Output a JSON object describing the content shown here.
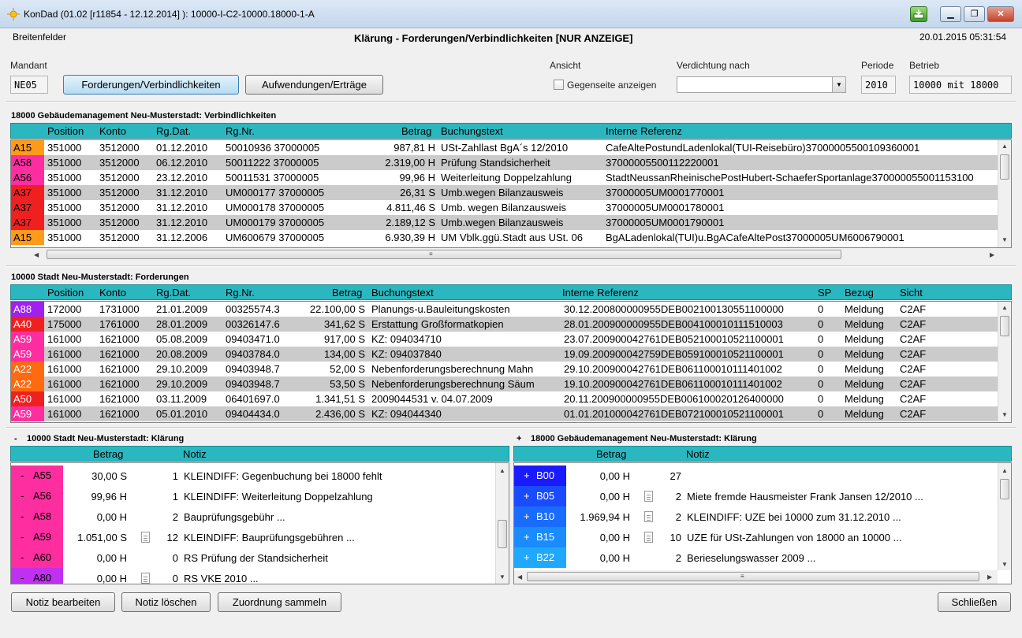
{
  "window": {
    "title": "KonDad (01.02 [r11854 - 12.12.2014] ): 10000-I-C2-10000.18000-1-A",
    "btn_min": "▁",
    "btn_max": "❐",
    "btn_close": "✕"
  },
  "header": {
    "user": "Breitenfelder",
    "title": "Klärung - Forderungen/Verbindlichkeiten [NUR ANZEIGE]",
    "timestamp": "20.01.2015 05:31:54"
  },
  "toolbar": {
    "mandant_label": "Mandant",
    "mandant_value": "NE05",
    "tab_forderungen": "Forderungen/Verbindlichkeiten",
    "tab_aufwendungen": "Aufwendungen/Erträge",
    "ansicht_label": "Ansicht",
    "gegenseite_label": "Gegenseite anzeigen",
    "verdichtung_label": "Verdichtung nach",
    "verdichtung_value": "",
    "periode_label": "Periode",
    "periode_value": "2010",
    "betrieb_label": "Betrieb",
    "betrieb_value": "10000 mit 18000"
  },
  "verbindlichkeiten": {
    "title": "18000 Gebäudemanagement Neu-Musterstadt: Verbindlichkeiten",
    "columns": [
      "Position",
      "Konto",
      "Rg.Dat.",
      "Rg.Nr.",
      "Betrag",
      "Buchungstext",
      "Interne Referenz"
    ],
    "rows": [
      {
        "code": "A15",
        "color": "#ff9a1a",
        "pos": "351000",
        "konto": "3512000",
        "dat": "01.12.2010",
        "nr": "50010936 37000005",
        "betrag": "987,81 H",
        "text": "USt-Zahllast BgA´s 12/2010",
        "ref": "CafeAltePostundLadenlokal(TUI-Reisebüro)37000005500109360001"
      },
      {
        "code": "A58",
        "color": "#ff2ea0",
        "pos": "351000",
        "konto": "3512000",
        "dat": "06.12.2010",
        "nr": "50011222 37000005",
        "betrag": "2.319,00 H",
        "text": "Prüfung Standsicherheit",
        "ref": "37000005500112220001"
      },
      {
        "code": "A56",
        "color": "#ff2ea0",
        "pos": "351000",
        "konto": "3512000",
        "dat": "23.12.2010",
        "nr": "50011531 37000005",
        "betrag": "99,96 H",
        "text": "Weiterleitung Doppelzahlung",
        "ref": "StadtNeussanRheinischePostHubert-SchaeferSportanlage370000055001153100"
      },
      {
        "code": "A37",
        "color": "#f02020",
        "pos": "351000",
        "konto": "3512000",
        "dat": "31.12.2010",
        "nr": "UM000177 37000005",
        "betrag": "26,31 S",
        "text": "Umb.wegen Bilanzausweis",
        "ref": "37000005UM0001770001"
      },
      {
        "code": "A37",
        "color": "#f02020",
        "pos": "351000",
        "konto": "3512000",
        "dat": "31.12.2010",
        "nr": "UM000178 37000005",
        "betrag": "4.811,46 S",
        "text": "Umb. wegen Bilanzausweis",
        "ref": "37000005UM0001780001"
      },
      {
        "code": "A37",
        "color": "#f02020",
        "pos": "351000",
        "konto": "3512000",
        "dat": "31.12.2010",
        "nr": "UM000179 37000005",
        "betrag": "2.189,12 S",
        "text": "Umb.wegen Bilanzausweis",
        "ref": "37000005UM0001790001"
      },
      {
        "code": "A15",
        "color": "#ff9a1a",
        "pos": "351000",
        "konto": "3512000",
        "dat": "31.12.2006",
        "nr": "UM600679 37000005",
        "betrag": "6.930,39 H",
        "text": "UM Vblk.ggü.Stadt aus USt. 06",
        "ref": "BgALadenlokal(TUI)u.BgACafeAltePost37000005UM6006790001"
      }
    ]
  },
  "forderungen": {
    "title": "10000 Stadt Neu-Musterstadt: Forderungen",
    "columns": [
      "Position",
      "Konto",
      "Rg.Dat.",
      "Rg.Nr.",
      "Betrag",
      "Buchungstext",
      "Interne Referenz",
      "SP",
      "Bezug",
      "Sicht"
    ],
    "rows": [
      {
        "code": "A88",
        "color": "#a020f0",
        "pos": "172000",
        "konto": "1731000",
        "dat": "21.01.2009",
        "nr": "00325574.3",
        "betrag": "22.100,00 S",
        "text": "Planungs-u.Bauleitungskosten",
        "ref": "30.12.200800000955DEB002100130551100000",
        "sp": "0",
        "bezug": "Meldung",
        "sicht": "C2AF"
      },
      {
        "code": "A40",
        "color": "#f02020",
        "pos": "175000",
        "konto": "1761000",
        "dat": "28.01.2009",
        "nr": "00326147.6",
        "betrag": "341,62 S",
        "text": "Erstattung Großformatkopien",
        "ref": "28.01.200900000955DEB004100010111510003",
        "sp": "0",
        "bezug": "Meldung",
        "sicht": "C2AF"
      },
      {
        "code": "A59",
        "color": "#ff2ea0",
        "pos": "161000",
        "konto": "1621000",
        "dat": "05.08.2009",
        "nr": "09403471.0",
        "betrag": "917,00 S",
        "text": "KZ: 094034710",
        "ref": "23.07.200900042761DEB052100010521100001",
        "sp": "0",
        "bezug": "Meldung",
        "sicht": "C2AF"
      },
      {
        "code": "A59",
        "color": "#ff2ea0",
        "pos": "161000",
        "konto": "1621000",
        "dat": "20.08.2009",
        "nr": "09403784.0",
        "betrag": "134,00 S",
        "text": "KZ: 094037840",
        "ref": "19.09.200900042759DEB059100010521100001",
        "sp": "0",
        "bezug": "Meldung",
        "sicht": "C2AF"
      },
      {
        "code": "A22",
        "color": "#ff6a10",
        "pos": "161000",
        "konto": "1621000",
        "dat": "29.10.2009",
        "nr": "09403948.7",
        "betrag": "52,00 S",
        "text": "Nebenforderungsberechnung Mahn",
        "ref": "29.10.200900042761DEB061100010111401002",
        "sp": "0",
        "bezug": "Meldung",
        "sicht": "C2AF"
      },
      {
        "code": "A22",
        "color": "#ff6a10",
        "pos": "161000",
        "konto": "1621000",
        "dat": "29.10.2009",
        "nr": "09403948.7",
        "betrag": "53,50 S",
        "text": "Nebenforderungsberechnung Säum",
        "ref": "19.10.200900042761DEB061100010111401002",
        "sp": "0",
        "bezug": "Meldung",
        "sicht": "C2AF"
      },
      {
        "code": "A50",
        "color": "#f02020",
        "pos": "161000",
        "konto": "1621000",
        "dat": "03.11.2009",
        "nr": "06401697.0",
        "betrag": "1.341,51 S",
        "text": "2009044531 v. 04.07.2009",
        "ref": "20.11.200900000955DEB006100020126400000",
        "sp": "0",
        "bezug": "Meldung",
        "sicht": "C2AF"
      },
      {
        "code": "A59",
        "color": "#ff2ea0",
        "pos": "161000",
        "konto": "1621000",
        "dat": "05.01.2010",
        "nr": "09404434.0",
        "betrag": "2.436,00 S",
        "text": "KZ: 094044340",
        "ref": "01.01.201000042761DEB072100010521100001",
        "sp": "0",
        "bezug": "Meldung",
        "sicht": "C2AF"
      }
    ]
  },
  "klaerung_left": {
    "toggle": "-",
    "title": "10000 Stadt Neu-Musterstadt: Klärung",
    "columns": [
      "Betrag",
      "Notiz"
    ],
    "rows": [
      {
        "sign": "-",
        "code": "A55",
        "color": "#ff2ea0",
        "betrag": "30,00 S",
        "doc": false,
        "count": "1",
        "notiz": "KLEINDIFF: Gegenbuchung bei 18000 fehlt"
      },
      {
        "sign": "-",
        "code": "A56",
        "color": "#ff2ea0",
        "betrag": "99,96 H",
        "doc": false,
        "count": "1",
        "notiz": "KLEINDIFF: Weiterleitung Doppelzahlung"
      },
      {
        "sign": "-",
        "code": "A58",
        "color": "#ff2ea0",
        "betrag": "0,00 H",
        "doc": false,
        "count": "2",
        "notiz": "Bauprüfungsgebühr ..."
      },
      {
        "sign": "-",
        "code": "A59",
        "color": "#ff2ea0",
        "betrag": "1.051,00 S",
        "doc": true,
        "count": "12",
        "notiz": "KLEINDIFF: Bauprüfungsgebühren ..."
      },
      {
        "sign": "-",
        "code": "A60",
        "color": "#ff2ea0",
        "betrag": "0,00 H",
        "doc": false,
        "count": "0",
        "notiz": "RS Prüfung der Standsicherheit"
      },
      {
        "sign": "-",
        "code": "A80",
        "color": "#c030f0",
        "betrag": "0,00 H",
        "doc": true,
        "count": "0",
        "notiz": "RS VKE 2010 ..."
      }
    ]
  },
  "klaerung_right": {
    "toggle": "+",
    "title": "18000 Gebäudemanagement Neu-Musterstadt: Klärung",
    "columns": [
      "Betrag",
      "Notiz"
    ],
    "rows": [
      {
        "sign": "+",
        "code": "B00",
        "color": "#1a1aff",
        "betrag": "0,00 H",
        "doc": false,
        "count": "27",
        "notiz": ""
      },
      {
        "sign": "+",
        "code": "B05",
        "color": "#1a4cff",
        "betrag": "0,00 H",
        "doc": true,
        "count": "2",
        "notiz": "Miete fremde Hausmeister Frank Jansen 12/2010 ..."
      },
      {
        "sign": "+",
        "code": "B10",
        "color": "#1a6cff",
        "betrag": "1.969,94 H",
        "doc": true,
        "count": "2",
        "notiz": "KLEINDIFF: UZE bei 10000 zum 31.12.2010 ..."
      },
      {
        "sign": "+",
        "code": "B15",
        "color": "#1a8cff",
        "betrag": "0,00 H",
        "doc": true,
        "count": "10",
        "notiz": "UZE für USt-Zahlungen von 18000 an 10000 ..."
      },
      {
        "sign": "+",
        "code": "B22",
        "color": "#20a8ff",
        "betrag": "0,00 H",
        "doc": false,
        "count": "2",
        "notiz": "Berieselungswasser 2009 ..."
      }
    ]
  },
  "footer": {
    "notiz_bearbeiten": "Notiz bearbeiten",
    "notiz_loeschen": "Notiz löschen",
    "zuordnung_sammeln": "Zuordnung sammeln",
    "schliessen": "Schließen"
  },
  "icons": {
    "app": "sun-icon",
    "scroll_up": "▲",
    "scroll_down": "▼",
    "scroll_left": "◀",
    "scroll_right": "▶",
    "grip": "≡",
    "dropdown": "▼"
  }
}
